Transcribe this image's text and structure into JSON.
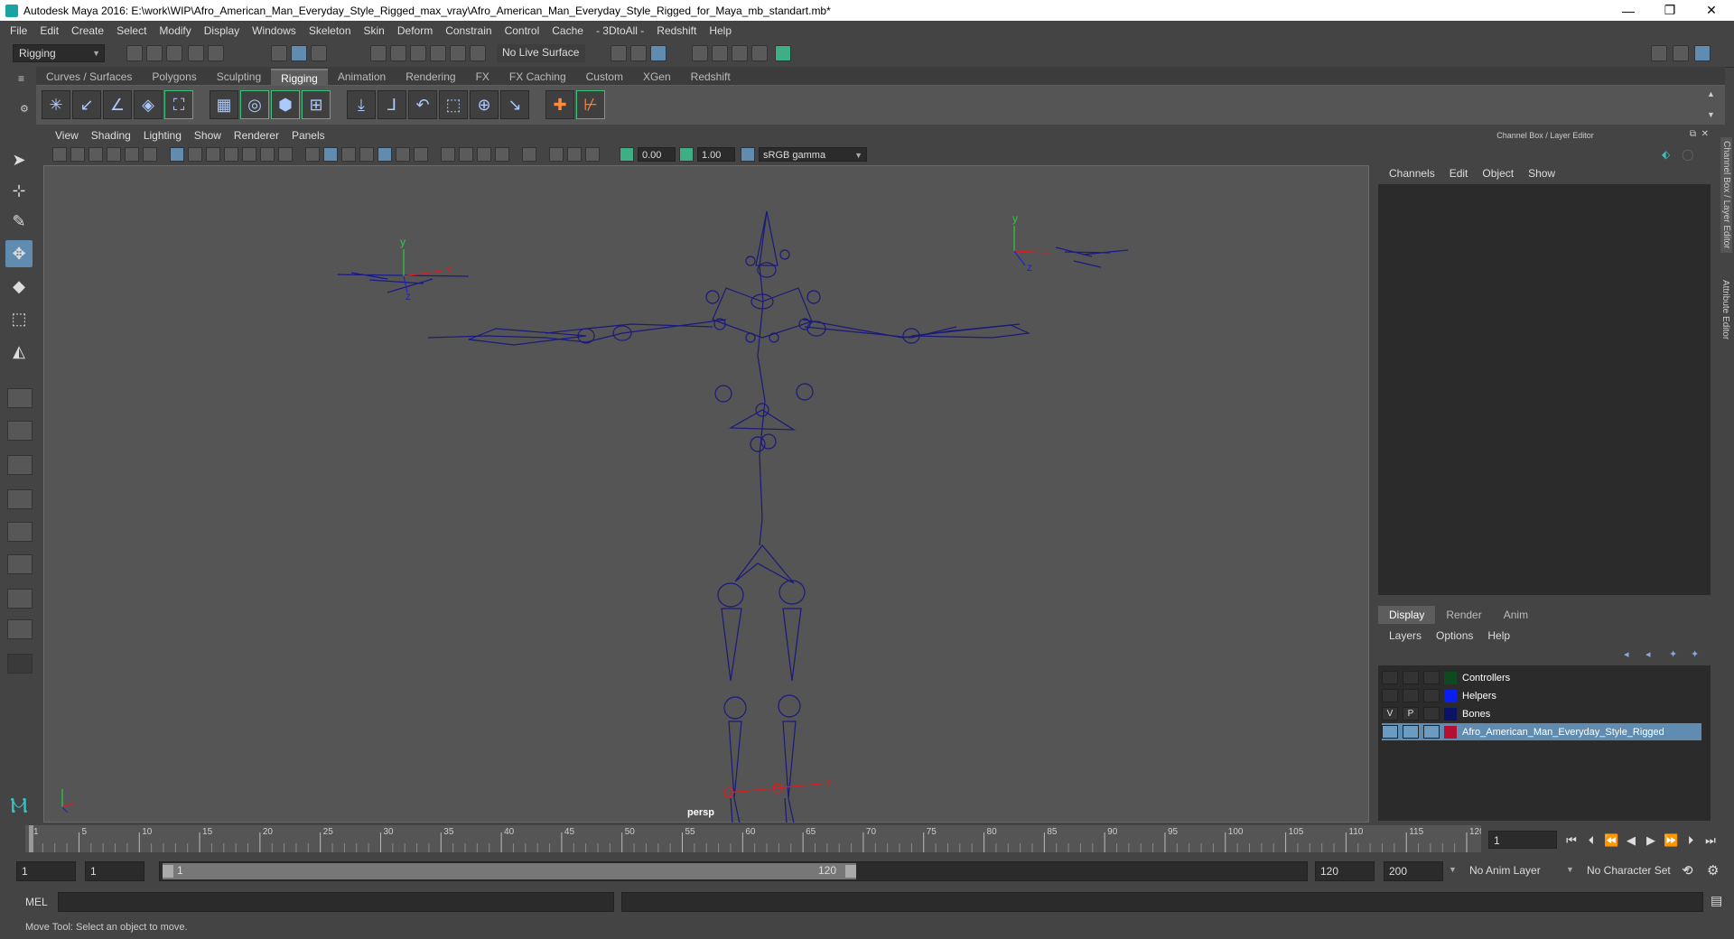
{
  "window": {
    "title": "Autodesk Maya 2016: E:\\work\\WIP\\Afro_American_Man_Everyday_Style_Rigged_max_vray\\Afro_American_Man_Everyday_Style_Rigged_for_Maya_mb_standart.mb*",
    "minimize": "—",
    "maximize": "❐",
    "close": "✕"
  },
  "menubar": [
    "File",
    "Edit",
    "Create",
    "Select",
    "Modify",
    "Display",
    "Windows",
    "Skeleton",
    "Skin",
    "Deform",
    "Constrain",
    "Control",
    "Cache",
    "- 3DtoAll -",
    "Redshift",
    "Help"
  ],
  "statusline": {
    "mode": "Rigging",
    "live_surface": "No Live Surface"
  },
  "shelf_tabs": [
    "Curves / Surfaces",
    "Polygons",
    "Sculpting",
    "Rigging",
    "Animation",
    "Rendering",
    "FX",
    "FX Caching",
    "Custom",
    "XGen",
    "Redshift"
  ],
  "shelf_active": "Rigging",
  "viewport": {
    "menu": [
      "View",
      "Shading",
      "Lighting",
      "Show",
      "Renderer",
      "Panels"
    ],
    "near_value": "0.00",
    "far_value": "1.00",
    "color_space": "sRGB gamma",
    "camera_label": "persp"
  },
  "channel_box": {
    "header": "Channel Box / Layer Editor",
    "menu": [
      "Channels",
      "Edit",
      "Object",
      "Show"
    ]
  },
  "layer_editor": {
    "tabs": [
      "Display",
      "Render",
      "Anim"
    ],
    "active_tab": "Display",
    "menu": [
      "Layers",
      "Options",
      "Help"
    ],
    "layers": [
      {
        "name": "Controllers",
        "v": "",
        "p": "",
        "color": "#0d4a1f",
        "selected": false
      },
      {
        "name": "Helpers",
        "v": "",
        "p": "",
        "color": "#0b1ef0",
        "selected": false
      },
      {
        "name": "Bones",
        "v": "V",
        "p": "P",
        "color": "#0b1366",
        "selected": false
      },
      {
        "name": "Afro_American_Man_Everyday_Style_Rigged",
        "v": "",
        "p": "",
        "color": "#b51032",
        "selected": true
      }
    ]
  },
  "side_tabs": [
    "Channel Box / Layer Editor",
    "Attribute Editor"
  ],
  "timeline": {
    "ticks": [
      "1",
      "5",
      "10",
      "15",
      "20",
      "25",
      "30",
      "35",
      "40",
      "45",
      "50",
      "55",
      "60",
      "65",
      "70",
      "75",
      "80",
      "85",
      "90",
      "95",
      "100",
      "105",
      "110",
      "115",
      "120"
    ],
    "current_frame": "1"
  },
  "range": {
    "start": "1",
    "playback_start": "1",
    "slider_start": "1",
    "slider_end": "120",
    "playback_end": "120",
    "end": "200",
    "anim_layer": "No Anim Layer",
    "character_set": "No Character Set"
  },
  "command_line": {
    "label": "MEL"
  },
  "help_line": "Move Tool: Select an object to move."
}
